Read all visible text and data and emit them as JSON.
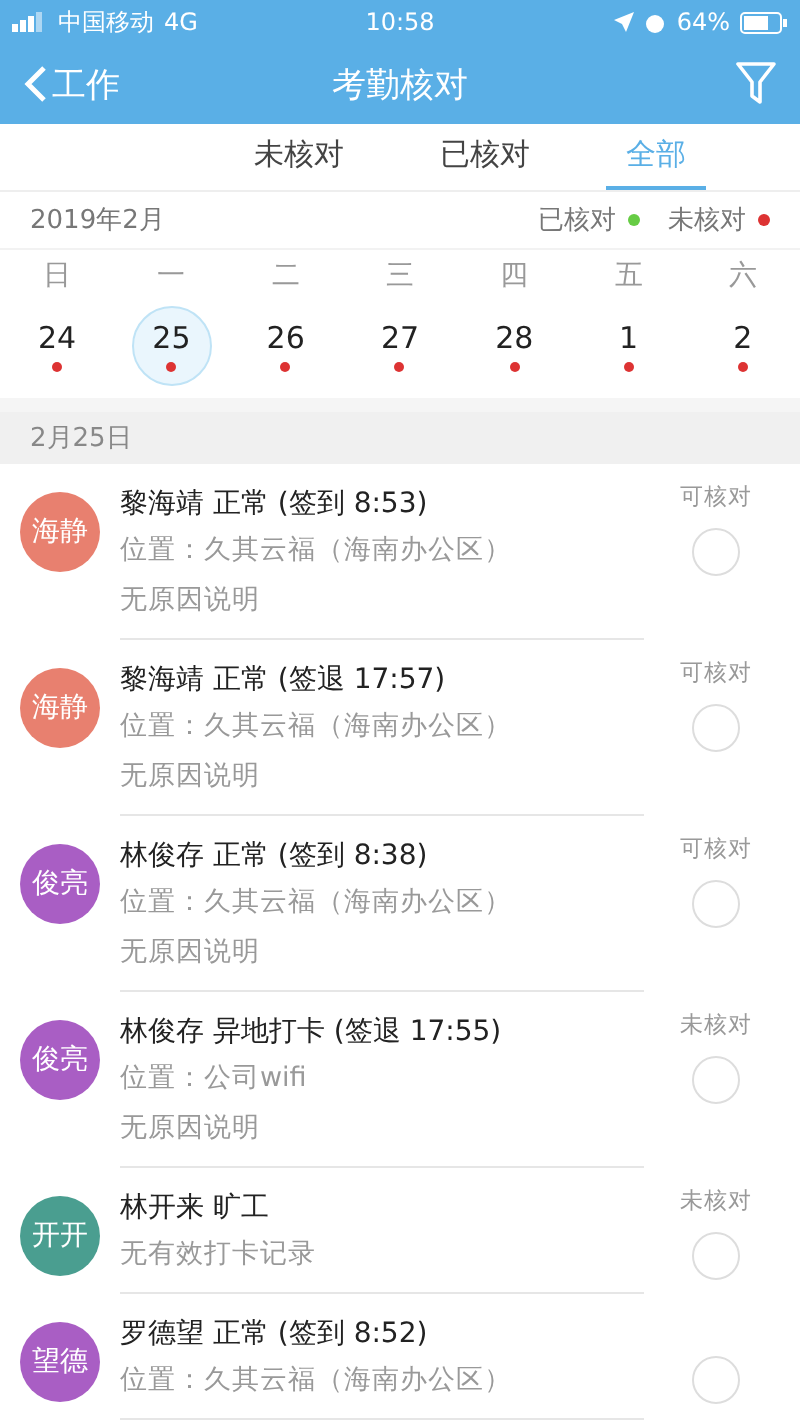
{
  "status_bar": {
    "carrier": "中国移动",
    "network": "4G",
    "time": "10:58",
    "battery": "64%"
  },
  "nav": {
    "back": "工作",
    "title": "考勤核对"
  },
  "tabs": [
    {
      "label": "未核对",
      "selected": false
    },
    {
      "label": "已核对",
      "selected": false
    },
    {
      "label": "全部",
      "selected": true
    }
  ],
  "month": "2019年2月",
  "legend": [
    {
      "label": "已核对",
      "color": "#66cc44"
    },
    {
      "label": "未核对",
      "color": "#dd3333"
    }
  ],
  "weekdays": [
    "日",
    "一",
    "二",
    "三",
    "四",
    "五",
    "六"
  ],
  "days": [
    {
      "date": "24",
      "selected": false,
      "color": "#dd3333"
    },
    {
      "date": "25",
      "selected": true,
      "color": "#dd3333"
    },
    {
      "date": "26",
      "selected": false,
      "color": "#dd3333"
    },
    {
      "date": "27",
      "selected": false,
      "color": "#dd3333"
    },
    {
      "date": "28",
      "selected": false,
      "color": "#dd3333"
    },
    {
      "date": "1",
      "selected": false,
      "color": "#dd3333"
    },
    {
      "date": "2",
      "selected": false,
      "color": "#dd3333"
    }
  ],
  "section": "2月25日",
  "records": [
    {
      "avatar": "海静",
      "color": "#e8806f",
      "title": "黎海靖 正常 (签到 8:53)",
      "lines": [
        "位置：久其云福（海南办公区）",
        "无原因说明"
      ],
      "status": "可核对",
      "checked": false
    },
    {
      "avatar": "海静",
      "color": "#e8806f",
      "title": "黎海靖 正常 (签退 17:57)",
      "lines": [
        "位置：久其云福（海南办公区）",
        "无原因说明"
      ],
      "status": "可核对",
      "checked": false
    },
    {
      "avatar": "俊亮",
      "color": "#a95ec4",
      "title": "林俊存 正常 (签到 8:38)",
      "lines": [
        "位置：久其云福（海南办公区）",
        "无原因说明"
      ],
      "status": "可核对",
      "checked": false
    },
    {
      "avatar": "俊亮",
      "color": "#a95ec4",
      "title": "林俊存 异地打卡 (签退 17:55)",
      "lines": [
        "位置：公司wifi",
        "无原因说明"
      ],
      "status": "未核对",
      "checked": false
    },
    {
      "avatar": "开开",
      "color": "#4a9e90",
      "title": "林开来 旷工",
      "lines": [
        "无有效打卡记录"
      ],
      "status": "未核对",
      "checked": false
    },
    {
      "avatar": "望德",
      "color": "#a95ec4",
      "title": "罗德望 正常 (签到 8:52)",
      "lines": [
        "位置：久其云福（海南办公区）"
      ],
      "checked": false
    }
  ]
}
